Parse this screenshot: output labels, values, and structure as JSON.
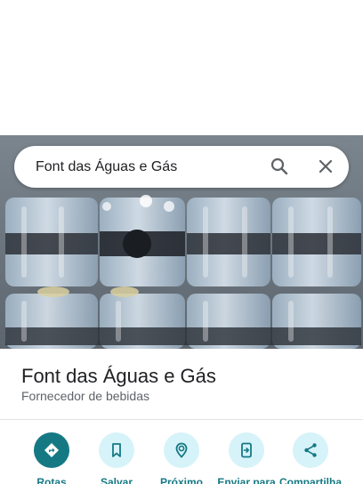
{
  "search": {
    "query": "Font das Águas e Gás",
    "search_icon": "search-icon",
    "close_icon": "close-icon"
  },
  "place": {
    "name": "Font das Águas e Gás",
    "category": "Fornecedor de bebidas",
    "photo": "bottled-water-packs-photo"
  },
  "actions": [
    {
      "label": "Rotas",
      "icon": "directions-icon"
    },
    {
      "label": "Salvar",
      "icon": "bookmark-icon"
    },
    {
      "label": "Próximo",
      "icon": "nearby-icon"
    },
    {
      "label": "Enviar para",
      "icon": "send-to-phone-icon"
    },
    {
      "label": "Compartilha",
      "icon": "share-icon"
    }
  ],
  "colors": {
    "accent": "#157984",
    "action_bg": "#d6f3f9",
    "title_text": "#202124",
    "secondary_text": "#5f6368"
  }
}
